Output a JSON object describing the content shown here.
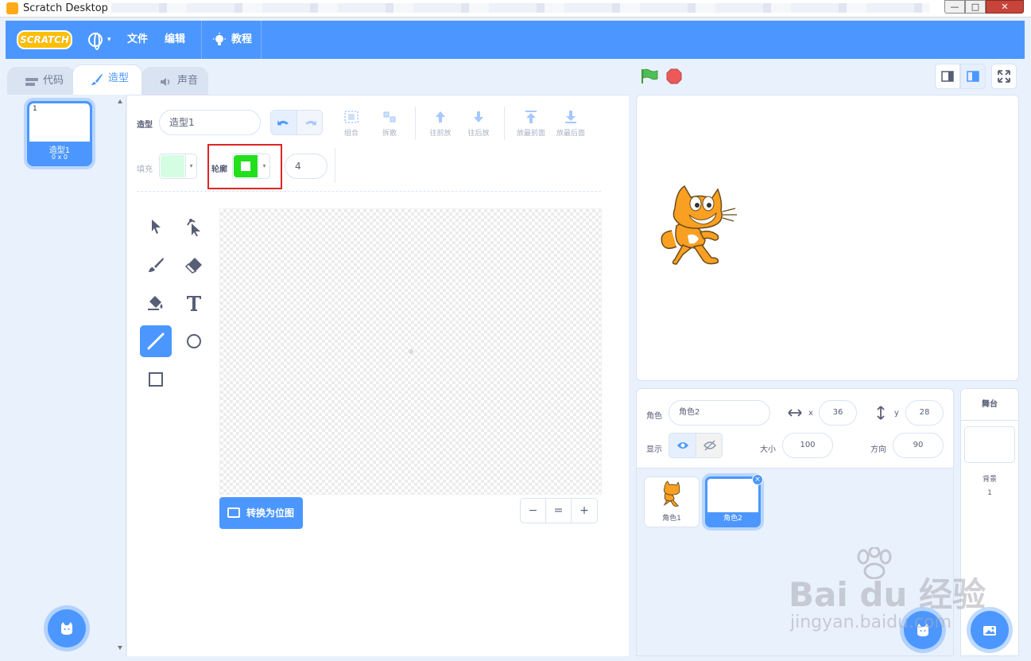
{
  "window": {
    "title": "Scratch Desktop",
    "min_glyph": "—",
    "max_glyph": "□",
    "close_glyph": "✕"
  },
  "menubar": {
    "logo": "SCRATCH",
    "language_caret": "▾",
    "file": "文件",
    "edit": "编辑",
    "tutorials": "教程",
    "brand_color": "#4c97ff"
  },
  "tabs": [
    {
      "label": "代码",
      "icon": "code-icon"
    },
    {
      "label": "造型",
      "icon": "brush-icon",
      "active": true
    },
    {
      "label": "声音",
      "icon": "speaker-icon"
    }
  ],
  "costumes": [
    {
      "number": "1",
      "name": "造型1",
      "size": "0 x 0",
      "selected": true
    }
  ],
  "paint": {
    "costume_label": "造型",
    "costume_name": "造型1",
    "actions": [
      {
        "label": "组合",
        "icon": "group-icon"
      },
      {
        "label": "拆散",
        "icon": "ungroup-icon"
      },
      {
        "label": "往前放",
        "icon": "forward-icon"
      },
      {
        "label": "往后放",
        "icon": "backward-icon"
      },
      {
        "label": "放最前面",
        "icon": "front-icon"
      },
      {
        "label": "放最后面",
        "icon": "back-icon"
      }
    ],
    "fill_label": "填充",
    "fill_color": "#d5fde2",
    "outline_label": "轮廓",
    "outline_color": "#22e01c",
    "outline_width": "4",
    "convert_label": "转换为位图",
    "zoom_out": "−",
    "zoom_reset": "=",
    "zoom_in": "+",
    "caret": "▾"
  },
  "stage": {
    "flag_color": "#4cbf56",
    "stop_color": "#ec5959"
  },
  "sprite_info": {
    "sprite_label": "角色",
    "sprite_name": "角色2",
    "x_label": "x",
    "x_value": "36",
    "y_label": "y",
    "y_value": "28",
    "show_label": "显示",
    "size_label": "大小",
    "size_value": "100",
    "direction_label": "方向",
    "direction_value": "90"
  },
  "sprites": [
    {
      "name": "角色1",
      "selected": false
    },
    {
      "name": "角色2",
      "selected": true
    }
  ],
  "stage_selector": {
    "header": "舞台",
    "backdrops_label": "背景",
    "backdrops_count": "1"
  },
  "watermark": {
    "brand": "Bai du 经验",
    "url": "jingyan.baidu.com"
  }
}
